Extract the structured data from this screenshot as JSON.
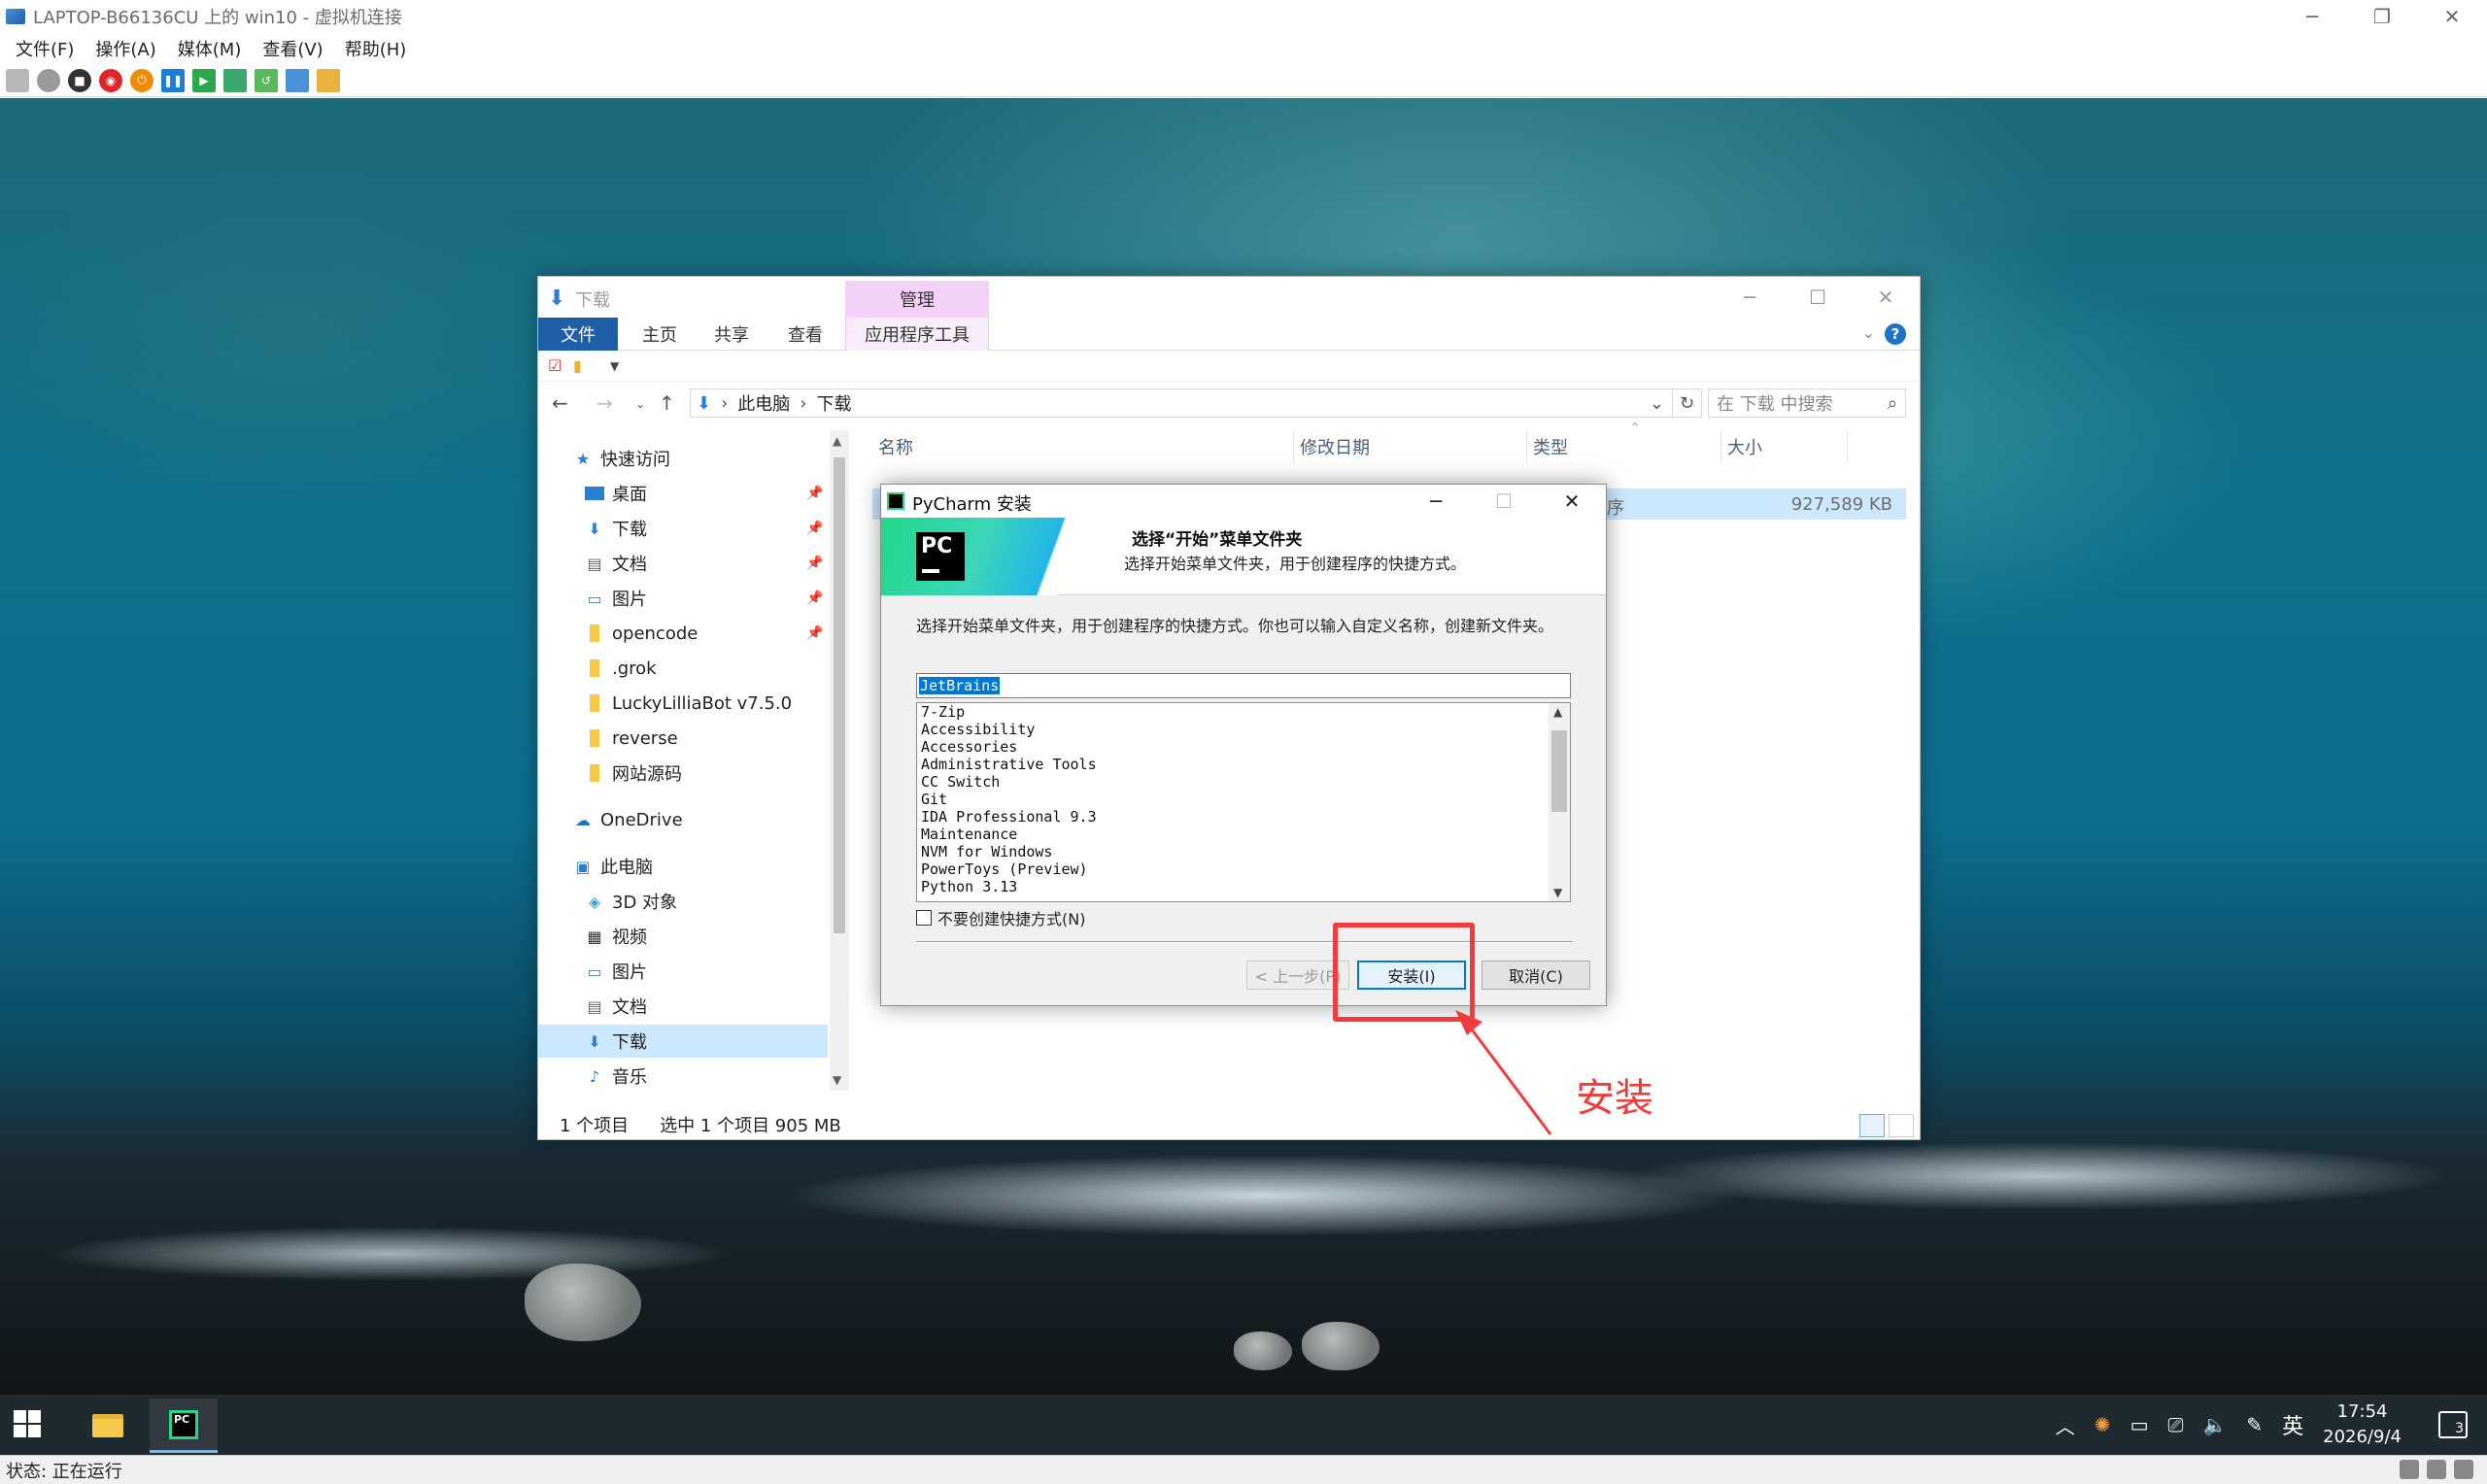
{
  "host": {
    "title": "LAPTOP-B66136CU 上的 win10 - 虚拟机连接",
    "menu": [
      "文件(F)",
      "操作(A)",
      "媒体(M)",
      "查看(V)",
      "帮助(H)"
    ],
    "status": "状态: 正在运行",
    "window_controls": [
      "─",
      "❐",
      "✕"
    ]
  },
  "explorer": {
    "title": "下载",
    "context_tab": "管理",
    "tabs": [
      "文件",
      "主页",
      "共享",
      "查看",
      "应用程序工具"
    ],
    "breadcrumb": [
      "此电脑",
      "下载"
    ],
    "search_placeholder": "在 下载 中搜索",
    "nav": {
      "quick_access": "快速访问",
      "pinned": [
        "桌面",
        "下载",
        "文档",
        "图片",
        "opencode"
      ],
      "folders": [
        ".grok",
        "LuckyLilliaBot v7.5.0",
        "reverse",
        "网站源码"
      ],
      "onedrive": "OneDrive",
      "this_pc": "此电脑",
      "pc_items": [
        "3D 对象",
        "视频",
        "图片",
        "文档",
        "下载",
        "音乐"
      ]
    },
    "columns": [
      "名称",
      "修改日期",
      "类型",
      "大小"
    ],
    "file_row": {
      "type_fragment": "序",
      "size": "927,589 KB"
    },
    "status_items": "1 个项目",
    "status_selected": "选中 1 个项目  905 MB"
  },
  "installer": {
    "title": "PyCharm 安装",
    "header_title": "选择“开始”菜单文件夹",
    "header_subtitle": "选择开始菜单文件夹，用于创建程序的快捷方式。",
    "description": "选择开始菜单文件夹，用于创建程序的快捷方式。你也可以输入自定义名称，创建新文件夹。",
    "folder_value": "JetBrains",
    "folders": [
      "7-Zip",
      "Accessibility",
      "Accessories",
      "Administrative Tools",
      "CC Switch",
      "Git",
      "IDA Professional 9.3",
      "Maintenance",
      "NVM for Windows",
      "PowerToys (Preview)",
      "Python 3.13"
    ],
    "checkbox_label": "不要创建快捷方式(N)",
    "back_button": "< 上一步(P)",
    "install_button": "安装(I)",
    "cancel_button": "取消(C)",
    "logo_text": "PC"
  },
  "annotation": {
    "label": "安装",
    "color": "#f23b3b"
  },
  "taskbar": {
    "time": "17:54",
    "date": "2026/9/4",
    "ime": "英",
    "notif_count": "3"
  }
}
